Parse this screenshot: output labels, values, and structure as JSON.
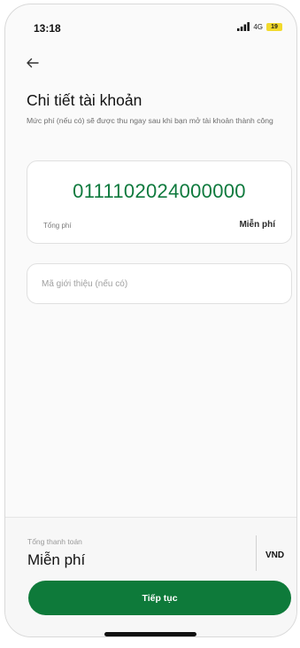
{
  "status_bar": {
    "time": "13:18",
    "network": "4G",
    "battery": "19",
    "battery_color": "#f2da2c"
  },
  "header": {
    "back_icon": "arrow-left-icon",
    "title": "Chi tiết tài khoản",
    "subtitle": "Mức phí (nếu có) sẽ được thu ngay sau khi bạn mở tài khoản thành công"
  },
  "account_card": {
    "account_number": "0111102024000000",
    "fee_label": "Tổng phí",
    "fee_value": "Miễn phí"
  },
  "referral": {
    "placeholder": "Mã giới thiệu (nếu có)",
    "value": ""
  },
  "footer": {
    "total_label": "Tổng thanh toán",
    "total_value": "Miễn phí",
    "currency": "VND",
    "continue_label": "Tiếp tục"
  },
  "colors": {
    "primary_green": "#0e7a3a",
    "account_number_green": "#0f7a3e"
  }
}
